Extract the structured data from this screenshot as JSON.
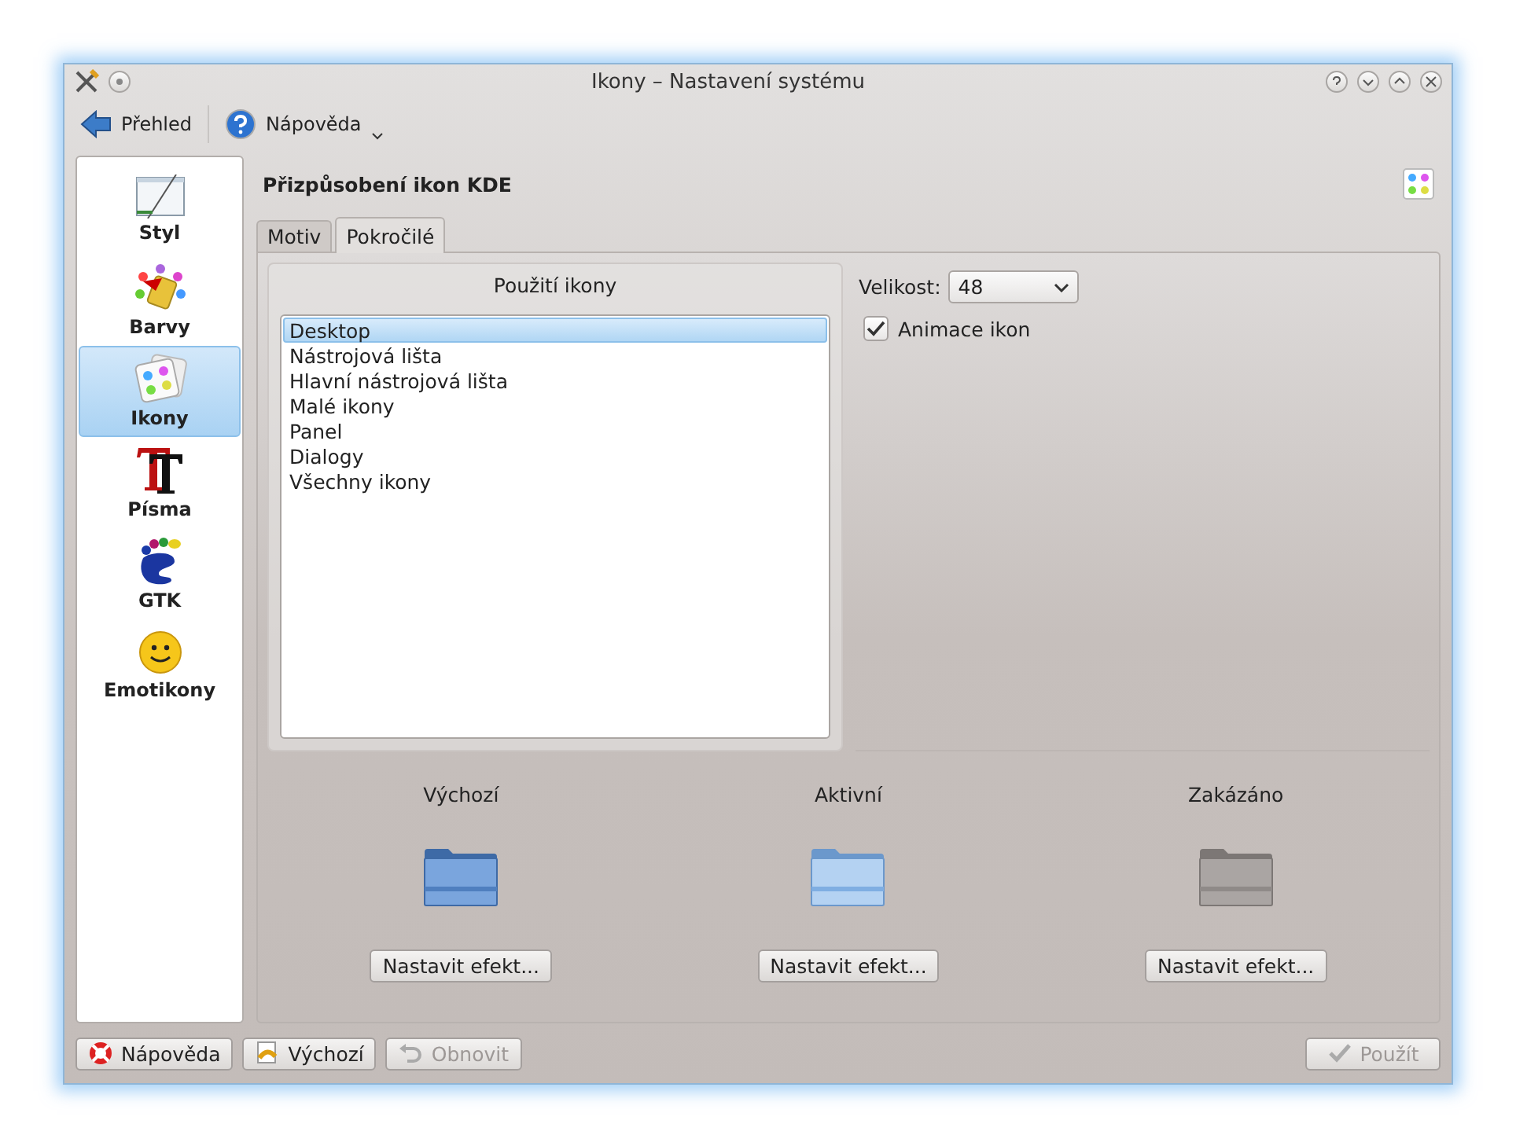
{
  "window": {
    "title": "Ikony – Nastavení systému"
  },
  "toolbar": [
    {
      "label": "Přehled",
      "kind": "back"
    },
    {
      "label": "Nápověda",
      "kind": "help"
    }
  ],
  "sidebar": {
    "items": [
      {
        "label": "Styl",
        "selected": false
      },
      {
        "label": "Barvy",
        "selected": false
      },
      {
        "label": "Ikony",
        "selected": true
      },
      {
        "label": "Písma",
        "selected": false
      },
      {
        "label": "GTK",
        "selected": false
      },
      {
        "label": "Emotikony",
        "selected": false
      }
    ]
  },
  "header": {
    "title": "Přizpůsobení ikon KDE"
  },
  "tabs": [
    {
      "label": "Motiv",
      "selected": false
    },
    {
      "label": "Pokročilé",
      "selected": true
    }
  ],
  "usage": {
    "title": "Použití ikony",
    "items": [
      {
        "label": "Desktop",
        "selected": true
      },
      {
        "label": "Nástrojová lišta",
        "selected": false
      },
      {
        "label": "Hlavní nástrojová lišta",
        "selected": false
      },
      {
        "label": "Malé ikony",
        "selected": false
      },
      {
        "label": "Panel",
        "selected": false
      },
      {
        "label": "Dialogy",
        "selected": false
      },
      {
        "label": "Všechny ikony",
        "selected": false
      }
    ]
  },
  "size": {
    "label": "Velikost:",
    "value": "48"
  },
  "animation": {
    "label": "Animace ikon",
    "checked": true
  },
  "states": [
    {
      "label": "Výchozí",
      "kind": "default",
      "button": "Nastavit efekt..."
    },
    {
      "label": "Aktivní",
      "kind": "active",
      "button": "Nastavit efekt..."
    },
    {
      "label": "Zakázáno",
      "kind": "disabled",
      "button": "Nastavit efekt..."
    }
  ],
  "footer": {
    "left": [
      {
        "label": "Nápověda",
        "kind": "help",
        "disabled": false
      },
      {
        "label": "Výchozí",
        "kind": "defaults",
        "disabled": false
      },
      {
        "label": "Obnovit",
        "kind": "reset",
        "disabled": true
      }
    ],
    "right": [
      {
        "label": "Použít",
        "kind": "apply",
        "disabled": true
      }
    ]
  }
}
